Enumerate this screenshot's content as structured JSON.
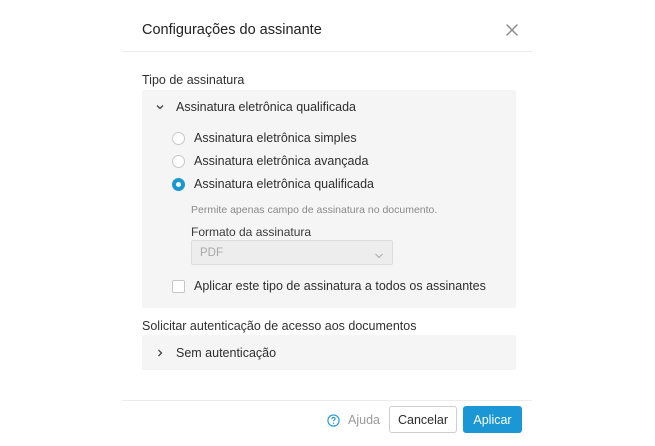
{
  "dialog": {
    "title": "Configurações do assinante",
    "close_icon": "close-icon"
  },
  "signature_type": {
    "section_label": "Tipo de assinatura",
    "accordion_label": "Assinatura eletrônica qualificada",
    "options": [
      {
        "label": "Assinatura eletrônica simples",
        "selected": false
      },
      {
        "label": "Assinatura eletrônica avançada",
        "selected": false
      },
      {
        "label": "Assinatura eletrônica qualificada",
        "selected": true
      }
    ],
    "hint": "Permite apenas campo de assinatura no documento.",
    "format": {
      "label": "Formato da assinatura",
      "value": "PDF"
    },
    "apply_all": {
      "label": "Aplicar este tipo de assinatura a todos os assinantes",
      "checked": false
    }
  },
  "authentication": {
    "section_label": "Solicitar autenticação de acesso aos documentos",
    "accordion_label": "Sem autenticação"
  },
  "footer": {
    "help_label": "Ajuda",
    "cancel_label": "Cancelar",
    "apply_label": "Aplicar"
  },
  "colors": {
    "accent": "#1a97d4",
    "panel_bg": "#f5f5f5"
  }
}
